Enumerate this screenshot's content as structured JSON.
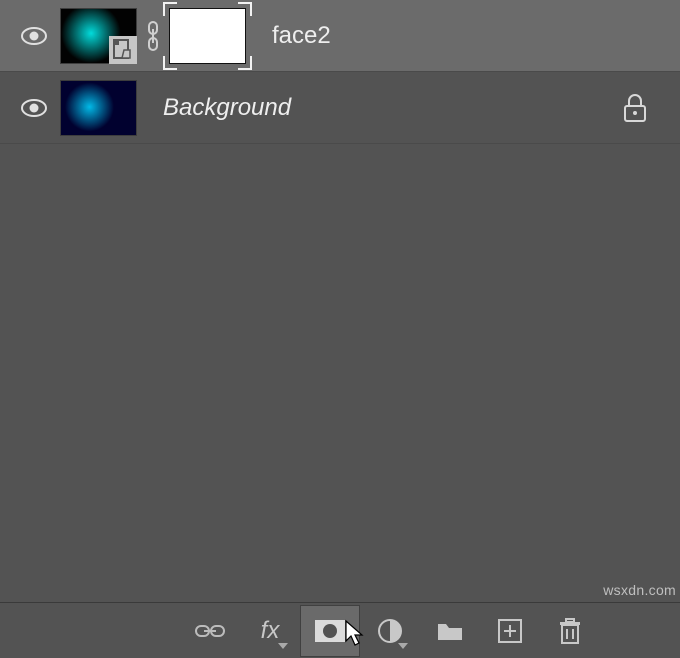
{
  "layers": [
    {
      "name": "face2",
      "italic": false,
      "selected": true,
      "has_mask": true,
      "locked": false,
      "smart_object": true,
      "linked": true
    },
    {
      "name": "Background",
      "italic": true,
      "selected": false,
      "has_mask": false,
      "locked": true,
      "smart_object": false,
      "linked": false
    }
  ],
  "toolbar": {
    "link": "Link layers",
    "fx": "Add layer style",
    "mask": "Add layer mask",
    "adjust": "New fill or adjustment layer",
    "group": "Create new group",
    "new": "Create new layer",
    "delete": "Delete layer"
  },
  "watermark": "wsxdn.com"
}
